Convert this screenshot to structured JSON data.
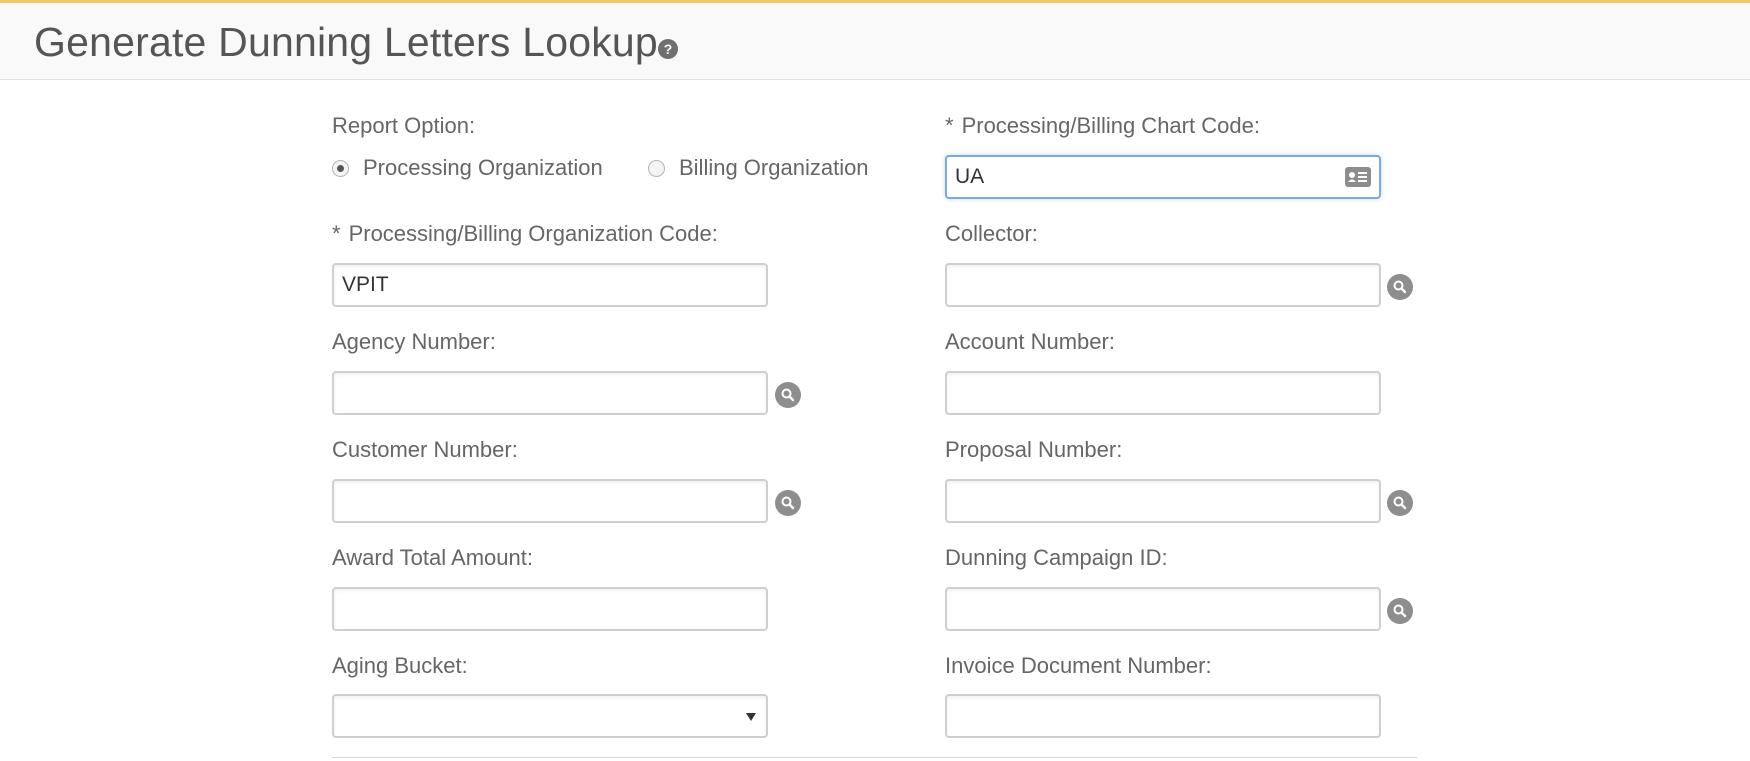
{
  "header": {
    "title": "Generate Dunning Letters Lookup",
    "help_icon": "question-circle-icon"
  },
  "form": {
    "report_option": {
      "label": "Report Option:",
      "options": [
        {
          "label": "Processing Organization",
          "checked": true
        },
        {
          "label": "Billing Organization",
          "checked": false
        }
      ]
    },
    "chart_code": {
      "required_mark": "*",
      "label": "Processing/Billing Chart Code:",
      "value": "UA",
      "icon": "address-card-icon"
    },
    "org_code": {
      "required_mark": "*",
      "label": "Processing/Billing Organization Code:",
      "value": "VPIT"
    },
    "collector": {
      "label": "Collector:",
      "value": "",
      "icon": "search-icon"
    },
    "agency_number": {
      "label": "Agency Number:",
      "value": "",
      "icon": "search-icon"
    },
    "account_number": {
      "label": "Account Number:",
      "value": ""
    },
    "customer_number": {
      "label": "Customer Number:",
      "value": "",
      "icon": "search-icon"
    },
    "proposal_number": {
      "label": "Proposal Number:",
      "value": "",
      "icon": "search-icon"
    },
    "award_total_amount": {
      "label": "Award Total Amount:",
      "value": ""
    },
    "dunning_campaign_id": {
      "label": "Dunning Campaign ID:",
      "value": "",
      "icon": "search-icon"
    },
    "aging_bucket": {
      "label": "Aging Bucket:",
      "selected": ""
    },
    "invoice_document_number": {
      "label": "Invoice Document Number:",
      "value": ""
    }
  },
  "colors": {
    "header_accent": "#f0c86a",
    "focus_border": "#7ea7e8",
    "icon_gray": "#8e8e8e"
  }
}
